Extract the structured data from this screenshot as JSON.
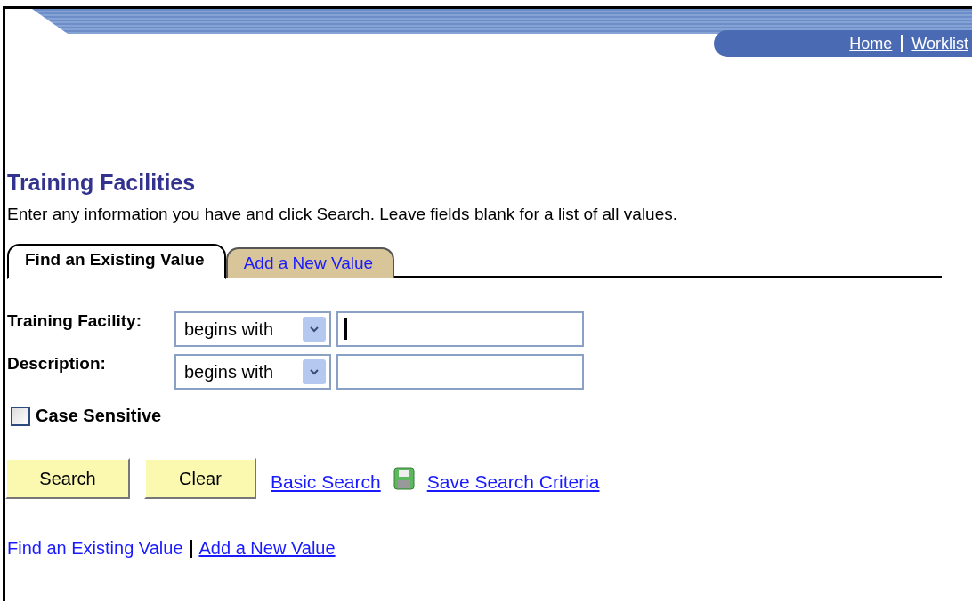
{
  "header": {
    "links": [
      {
        "label": "Home"
      },
      {
        "label": "Worklist"
      }
    ]
  },
  "page_title": "Training Facilities",
  "instructions": "Enter any information you have and click Search. Leave fields blank for a list of all values.",
  "tabs": [
    {
      "label": "Find an Existing Value",
      "selected": true
    },
    {
      "label": "Add a New Value",
      "selected": false
    }
  ],
  "fields": [
    {
      "label": "Training Facility:",
      "operator": "begins with",
      "focused": true
    },
    {
      "label": "Description:",
      "operator": "begins with",
      "focused": false
    }
  ],
  "case_sensitive": {
    "label": "Case Sensitive",
    "checked": false
  },
  "buttons": [
    {
      "label": "Search"
    },
    {
      "label": "Clear"
    }
  ],
  "links": [
    {
      "label": "Basic Search",
      "kind": "plain"
    },
    {
      "label": "Save Search Criteria",
      "kind": "save"
    }
  ],
  "footer_links": [
    {
      "label": "Find an Existing Value",
      "selected": true
    },
    {
      "label": "Add a New Value",
      "selected": false
    }
  ]
}
